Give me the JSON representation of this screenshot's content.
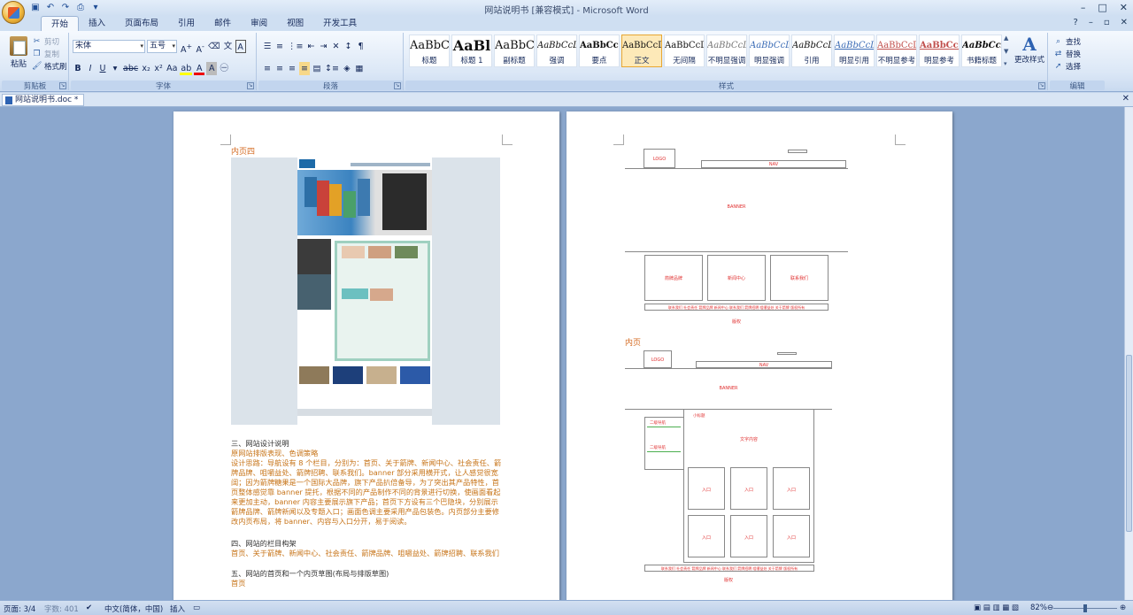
{
  "window": {
    "title": "网站说明书 [兼容模式] - Microsoft Word",
    "controls": [
      "–",
      "□",
      "✕"
    ]
  },
  "ribbon_tabs": [
    "开始",
    "插入",
    "页面布局",
    "引用",
    "邮件",
    "审阅",
    "视图",
    "开发工具"
  ],
  "clipboard": {
    "paste": "粘贴",
    "cut": "剪切",
    "copy": "复制",
    "format_painter": "格式刷",
    "label": "剪贴板"
  },
  "font": {
    "name": "宋体",
    "size": "五号",
    "label": "字体"
  },
  "paragraph": {
    "label": "段落"
  },
  "styles": {
    "label": "样式",
    "items": [
      {
        "preview": "AaBbC",
        "name": "标题"
      },
      {
        "preview": "AaBl",
        "name": "标题 1"
      },
      {
        "preview": "AaBbC",
        "name": "副标题"
      },
      {
        "preview": "AaBbCcDı",
        "name": "强调"
      },
      {
        "preview": "AaBbCcD",
        "name": "要点"
      },
      {
        "preview": "AaBbCcDı",
        "name": "正文"
      },
      {
        "preview": "AaBbCcDı",
        "name": "无间隔"
      },
      {
        "preview": "AaBbCcDı",
        "name": "不明显强调"
      },
      {
        "preview": "AaBbCcDı",
        "name": "明显强调"
      },
      {
        "preview": "AaBbCcDı",
        "name": "引用"
      },
      {
        "preview": "AaBbCcDı",
        "name": "明显引用"
      },
      {
        "preview": "AaBbCcD",
        "name": "不明显参考"
      },
      {
        "preview": "AaBbCcI",
        "name": "明显参考"
      },
      {
        "preview": "AaBbCcI",
        "name": "书籍标题"
      }
    ],
    "change_styles": "更改样式"
  },
  "editing": {
    "label": "编辑",
    "find": "查找",
    "replace": "替换",
    "select": "选择"
  },
  "document_tab": "网站说明书.doc *",
  "page1": {
    "heading": "内页四",
    "section3_title": "三、网站设计说明",
    "section3_sub": "原网站排版表现、色调策略",
    "section3_body": "设计思路：导航设有 8 个栏目，分别为：首页、关于箭牌、新闻中心、社会责任、箭牌品牌、咀嚼益处、箭牌招聘、联系我们。banner 部分采用横开式，让人感觉很宽阔；因为箭牌糖果是一个国际大品牌，旗下产品扒倍备导，为了突出其产品特性，首页整体感觉靠 banner 提托，根据不同的产品制作不同的背景进行切换，使画面看起来更加主动，banner 内容主要展示旗下产品；首页下方设有三个巴隐块，分别展示箭牌品牌、箭牌新闻以及专题入口；画面色调主要采用产品包装色。内页部分主要修改内页布局，将 banner、内容与入口分开，易于阅读。",
    "section4_title": "四、网站的栏目构架",
    "section4_body": "首页、关于箭牌、新闻中心、社会责任、箭牌品牌、咀嚼益处、箭牌招聘、联系我们",
    "section5_title": "五、网站的首页和一个内页草图(布局与排版草图)",
    "section5_sub": "首页"
  },
  "page2": {
    "wire1": {
      "logo": "LOGO",
      "nav": "NAV",
      "banner": "BANNER",
      "box1": "箭牌品牌",
      "box2": "新闻中心",
      "box3": "联系我们",
      "footer_links": "联系我们  社会责任  箭牌品牌  新闻中心  联系我们  箭牌招聘  咀嚼益处  关于箭牌  版权所有",
      "bottom": "版权"
    },
    "inner_heading": "内页",
    "wire2": {
      "logo": "LOGO",
      "nav": "NAV",
      "banner": "BANNER",
      "sub_nav": "小标题",
      "menu1": "二级导航",
      "menu2": "二级导航",
      "content": "文字内容",
      "entries": [
        "入口",
        "入口",
        "入口",
        "入口",
        "入口",
        "入口"
      ],
      "footer_links": "联系我们  社会责任  箭牌品牌  新闻中心  联系我们  箭牌招聘  咀嚼益处  关于箭牌  版权所有",
      "bottom": "版权"
    }
  },
  "status": {
    "page": "页面: 3/4",
    "words": "字数: 401",
    "language": "中文(简体，中国)",
    "mode": "插入",
    "zoom": "82%"
  }
}
